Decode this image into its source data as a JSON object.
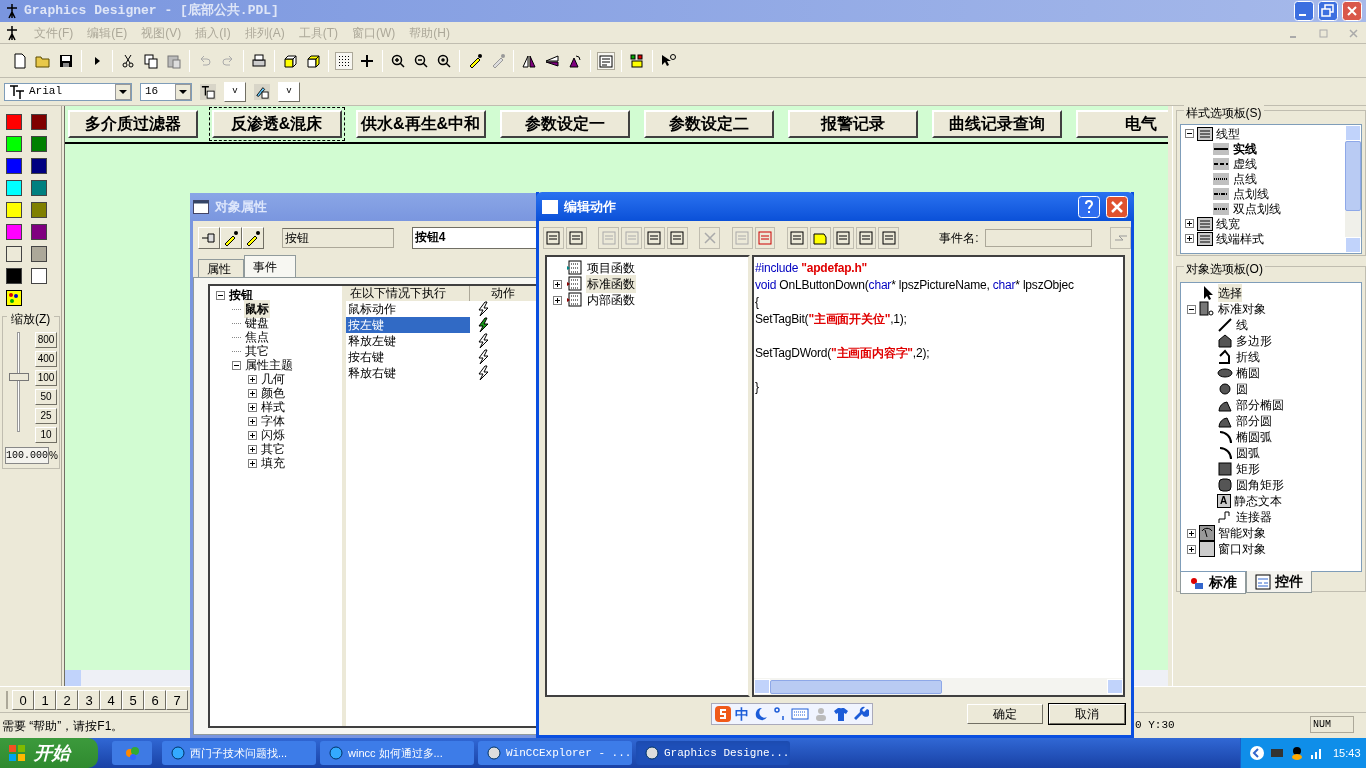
{
  "window": {
    "title": "Graphics Designer - [底部公共.PDL]"
  },
  "menu": [
    {
      "label": "文件(F)",
      "disabled": true
    },
    {
      "label": "编辑(E)",
      "disabled": true
    },
    {
      "label": "视图(V)",
      "disabled": true
    },
    {
      "label": "插入(I)",
      "disabled": true
    },
    {
      "label": "排列(A)",
      "disabled": true
    },
    {
      "label": "工具(T)",
      "disabled": true
    },
    {
      "label": "窗口(W)",
      "disabled": true
    },
    {
      "label": "帮助(H)",
      "disabled": true
    }
  ],
  "font_toolbar": {
    "font": "Arial",
    "size": "16",
    "buttons": [
      "v",
      "v"
    ]
  },
  "canvas_buttons": [
    {
      "label": "多介质过滤器",
      "selected": false
    },
    {
      "label": "反渗透&混床",
      "selected": true
    },
    {
      "label": "供水&再生&中和",
      "selected": false
    },
    {
      "label": "参数设定一",
      "selected": false
    },
    {
      "label": "参数设定二",
      "selected": false
    },
    {
      "label": "报警记录",
      "selected": false
    },
    {
      "label": "曲线记录查询",
      "selected": false
    },
    {
      "label": "电气",
      "selected": false
    }
  ],
  "colors": [
    {
      "color": "#ff0000"
    },
    {
      "color": "#800000"
    },
    {
      "color": "#00ff00"
    },
    {
      "color": "#008000"
    },
    {
      "color": "#0000ff"
    },
    {
      "color": "#000080"
    },
    {
      "color": "#00ffff"
    },
    {
      "color": "#008080"
    },
    {
      "color": "#ffff00"
    },
    {
      "color": "#808000"
    },
    {
      "color": "#ff00ff"
    },
    {
      "color": "#800080"
    },
    {
      "color": "#ece9d8"
    },
    {
      "color": "#aca899"
    },
    {
      "color": "#000000"
    },
    {
      "color": "#ffffff"
    }
  ],
  "zoom": {
    "title": "缩放(Z)",
    "marks": [
      "800",
      "400",
      "100",
      "50",
      "25",
      "10"
    ],
    "level": 0.55,
    "value": "100.000",
    "unit": "%"
  },
  "layers": [
    "0",
    "1",
    "2",
    "3",
    "4",
    "5",
    "6",
    "7"
  ],
  "status_bar": {
    "help": "需要 “帮助”，请按F1。",
    "position": "0 Y:30",
    "num": "NUM"
  },
  "taskbar": {
    "start": "开始",
    "tasks": [
      {
        "label": "西门子技术问题找...",
        "selected": false
      },
      {
        "label": "wincc 如何通过多...",
        "selected": false
      },
      {
        "label": "WinCCExplorer - ...",
        "selected": false
      },
      {
        "label": "Graphics Designe...",
        "selected": true
      }
    ],
    "clock": "15:43"
  },
  "object_properties": {
    "title": "对象属性",
    "type": "按钮",
    "name": "按钮4",
    "tabs": [
      {
        "label": "属性",
        "selected": false
      },
      {
        "label": "事件",
        "selected": true
      }
    ],
    "tree": [
      {
        "label": "按钮",
        "selected": false,
        "expanded": true,
        "children": [
          {
            "label": "鼠标",
            "selected": true
          },
          {
            "label": "键盘",
            "selected": false
          },
          {
            "label": "焦点",
            "selected": false
          },
          {
            "label": "其它",
            "selected": false
          },
          {
            "label": "属性主题",
            "selected": false,
            "expanded": true,
            "children": [
              {
                "label": "几何",
                "selected": false,
                "expanded": false
              },
              {
                "label": "颜色",
                "selected": false,
                "expanded": false
              },
              {
                "label": "样式",
                "selected": false,
                "expanded": false
              },
              {
                "label": "字体",
                "selected": false,
                "expanded": false
              },
              {
                "label": "闪烁",
                "selected": false,
                "expanded": false
              },
              {
                "label": "其它",
                "selected": false,
                "expanded": false
              },
              {
                "label": "填充",
                "selected": false,
                "expanded": false
              }
            ]
          }
        ]
      }
    ],
    "event_columns": [
      "在以下情况下执行",
      "动作"
    ],
    "events": [
      {
        "label": "鼠标动作",
        "selected": false,
        "configured": false
      },
      {
        "label": "按左键",
        "selected": true,
        "configured": true
      },
      {
        "label": "释放左键",
        "selected": false,
        "configured": false
      },
      {
        "label": "按右键",
        "selected": false,
        "configured": false
      },
      {
        "label": "释放右键",
        "selected": false,
        "configured": false
      }
    ]
  },
  "edit_action": {
    "title": "编辑动作",
    "event_name_label": "事件名:",
    "tree": [
      {
        "label": "项目函数",
        "selected": false
      },
      {
        "label": "标准函数",
        "selected": true,
        "expanded": false
      },
      {
        "label": "内部函数",
        "selected": false,
        "expanded": false
      }
    ],
    "code": [
      {
        "kind": "code",
        "segments": [
          {
            "kind": "keyword",
            "text": "#include "
          },
          {
            "kind": "string",
            "text": "\"apdefap.h\""
          }
        ]
      },
      {
        "kind": "code",
        "segments": [
          {
            "kind": "keyword",
            "text": "void"
          },
          {
            "kind": "plain",
            "text": " OnLButtonDown("
          },
          {
            "kind": "keyword",
            "text": "char"
          },
          {
            "kind": "plain",
            "text": "* lpszPictureName, "
          },
          {
            "kind": "keyword",
            "text": "char"
          },
          {
            "kind": "plain",
            "text": "* lpszObjec"
          }
        ]
      },
      {
        "kind": "code",
        "segments": [
          {
            "kind": "plain",
            "text": "{"
          }
        ]
      },
      {
        "kind": "code",
        "segments": [
          {
            "kind": "plain",
            "text": "SetTagBit("
          },
          {
            "kind": "string",
            "text": "\"主画面开关位\""
          },
          {
            "kind": "plain",
            "text": ",1);"
          }
        ]
      },
      {
        "kind": "blank"
      },
      {
        "kind": "code",
        "segments": [
          {
            "kind": "plain",
            "text": "SetTagDWord("
          },
          {
            "kind": "string",
            "text": "\"主画面内容字\""
          },
          {
            "kind": "plain",
            "text": ",2);"
          }
        ]
      },
      {
        "kind": "blank"
      },
      {
        "kind": "code",
        "segments": [
          {
            "kind": "plain",
            "text": "}"
          }
        ]
      }
    ],
    "ime": "中",
    "buttons": [
      "确定",
      "取消"
    ]
  },
  "style_palette": {
    "title": "样式选项板(S)",
    "tree": [
      {
        "label": "线型",
        "expanded": true,
        "children": [
          {
            "label": "实线",
            "kind": "solid",
            "selected": true
          },
          {
            "label": "虚线",
            "kind": "dash",
            "selected": false
          },
          {
            "label": "点线",
            "kind": "dot",
            "selected": false
          },
          {
            "label": "点划线",
            "kind": "dashdot",
            "selected": false
          },
          {
            "label": "双点划线",
            "kind": "dashdotdot",
            "selected": false
          }
        ]
      },
      {
        "label": "线宽",
        "expanded": false
      },
      {
        "label": "线端样式",
        "expanded": false
      }
    ]
  },
  "object_palette": {
    "title": "对象选项板(O)",
    "select": {
      "label": "选择",
      "selected": true
    },
    "group": {
      "label": "标准对象",
      "expanded": true,
      "children": [
        {
          "label": "线",
          "kind": "line"
        },
        {
          "label": "多边形",
          "kind": "polygon"
        },
        {
          "label": "折线",
          "kind": "polyline"
        },
        {
          "label": "椭圆",
          "kind": "ellipse"
        },
        {
          "label": "圆",
          "kind": "circle"
        },
        {
          "label": "部分椭圆",
          "kind": "pie"
        },
        {
          "label": "部分圆",
          "kind": "pie"
        },
        {
          "label": "椭圆弧",
          "kind": "arc"
        },
        {
          "label": "圆弧",
          "kind": "arc"
        },
        {
          "label": "矩形",
          "kind": "rectangle"
        },
        {
          "label": "圆角矩形",
          "kind": "rounded-rectangle"
        },
        {
          "label": "静态文本",
          "kind": "text",
          "icon_text": "A"
        },
        {
          "label": "连接器",
          "kind": "connector"
        }
      ]
    },
    "others": [
      {
        "label": "智能对象",
        "expanded": false
      },
      {
        "label": "窗口对象",
        "expanded": false
      }
    ],
    "tabs": [
      {
        "label": "标准",
        "selected": true
      },
      {
        "label": "控件",
        "selected": false
      }
    ]
  }
}
